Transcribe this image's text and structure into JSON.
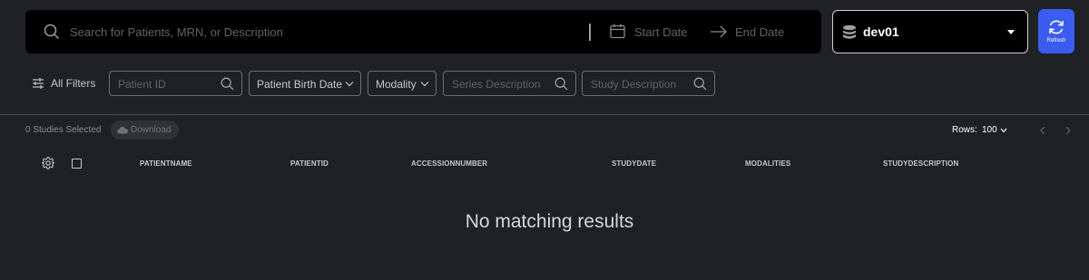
{
  "search": {
    "placeholder": "Search for Patients, MRN, or Description",
    "start_date": "Start Date",
    "end_date": "End Date"
  },
  "server": {
    "name": "dev01"
  },
  "refresh": {
    "label": "Refresh"
  },
  "filters": {
    "toggle_label": "All Filters",
    "patient_id_placeholder": "Patient ID",
    "birth_date_label": "Patient Birth Date",
    "modality_label": "Modality",
    "series_description_placeholder": "Series Description",
    "study_description_placeholder": "Study Description"
  },
  "selection": {
    "count_text": "0 Studies Selected",
    "download_label": "Download"
  },
  "pagination": {
    "rows_label": "Rows:",
    "rows_value": "100"
  },
  "table": {
    "columns": [
      "PATIENTNAME",
      "PATIENTID",
      "ACCESSIONNUMBER",
      "STUDYDATE",
      "MODALITIES",
      "STUDYDESCRIPTION"
    ],
    "empty_message": "No matching results"
  },
  "colors": {
    "background": "#202124",
    "accent": "#3b5cf0"
  }
}
